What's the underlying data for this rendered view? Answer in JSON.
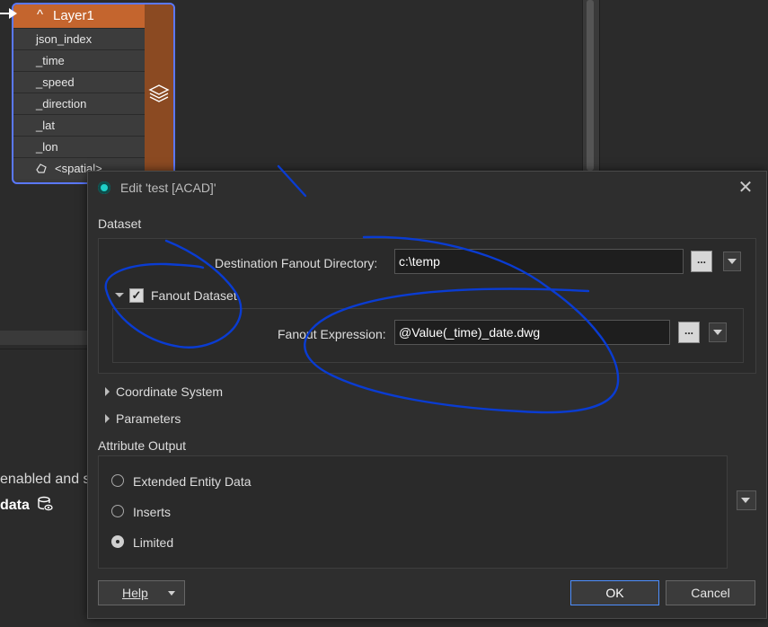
{
  "background": {
    "partial_text_1": "enabled and s",
    "partial_text_2": "data"
  },
  "node": {
    "title": "Layer1",
    "caret_symbol": "^",
    "attributes": [
      "json_index",
      "_time",
      "_speed",
      "_direction",
      "_lat",
      "_lon"
    ],
    "spatial_label": "<spatial>",
    "colors": {
      "header": "#c4652e",
      "side": "#8b4a22",
      "selection_border": "#5a78ff"
    }
  },
  "dialog": {
    "title": "Edit 'test [ACAD]'",
    "dataset_section": "Dataset",
    "dest_label": "Destination Fanout Directory:",
    "dest_value": "c:\\temp",
    "browse_label": "...",
    "fanout_checkbox_label": "Fanout Dataset",
    "fanout_checked": true,
    "check_mark": "✓",
    "expr_label": "Fanout Expression:",
    "expr_value": "@Value(_time)_date.dwg",
    "coord_section": "Coordinate System",
    "params_section": "Parameters",
    "attr_output_section": "Attribute Output",
    "attr_options": [
      {
        "label": "Extended Entity Data",
        "selected": false
      },
      {
        "label": "Inserts",
        "selected": false
      },
      {
        "label": "Limited",
        "selected": true
      }
    ],
    "help_label": "Help",
    "ok_label": "OK",
    "cancel_label": "Cancel",
    "close_symbol": "✕",
    "colors": {
      "accent": "#4e8fff",
      "logo": "#1fd0c8"
    }
  },
  "annotation": {
    "color": "#0a3cd2"
  }
}
